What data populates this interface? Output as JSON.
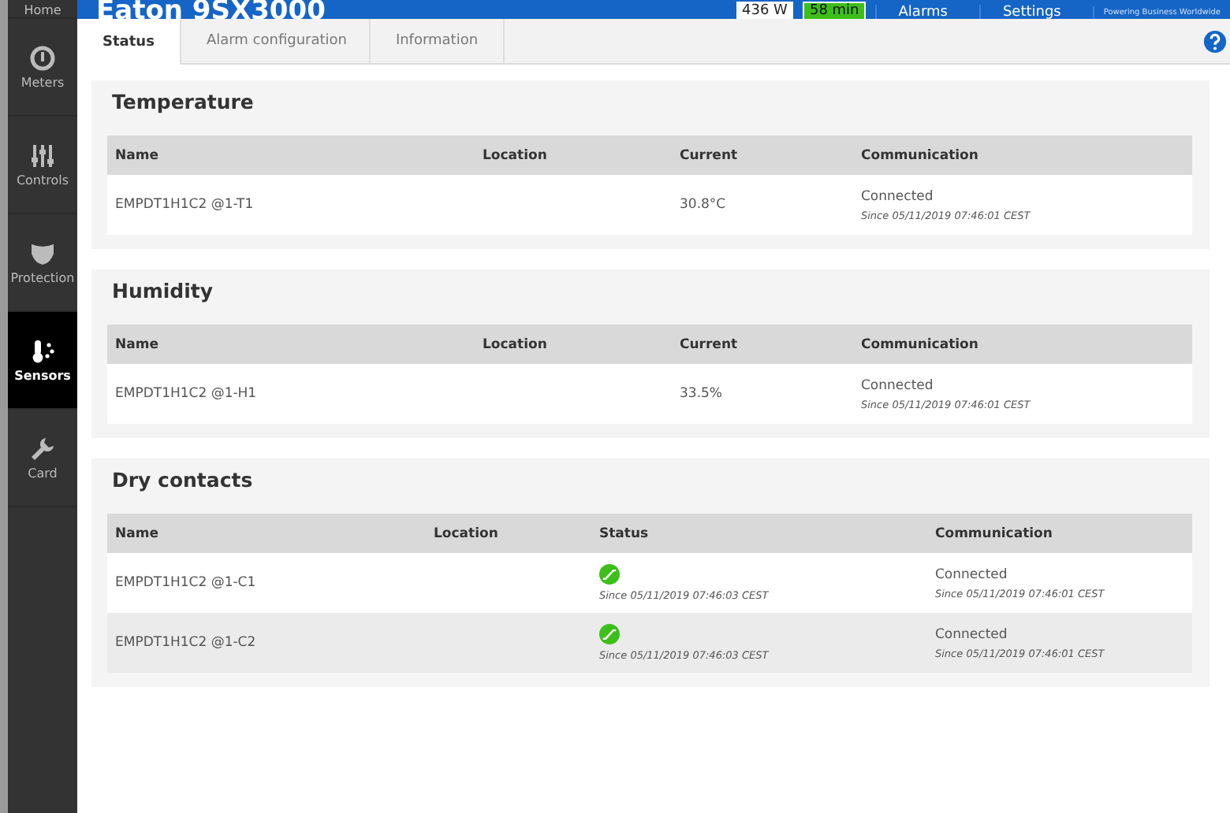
{
  "header": {
    "title": "Eaton 9SX3000",
    "power": "436 W",
    "runtime": "58 min",
    "menu": [
      "Alarms",
      "Settings"
    ],
    "tagline": "Powering Business Worldwide"
  },
  "sidebar": {
    "items": [
      {
        "label": "Home",
        "selected": false
      },
      {
        "label": "Meters",
        "selected": false
      },
      {
        "label": "Controls",
        "selected": false
      },
      {
        "label": "Protection",
        "selected": false
      },
      {
        "label": "Sensors",
        "selected": true
      },
      {
        "label": "Card",
        "selected": false
      }
    ]
  },
  "tabs": [
    {
      "label": "Status",
      "selected": true
    },
    {
      "label": "Alarm configuration",
      "selected": false
    },
    {
      "label": "Information",
      "selected": false
    }
  ],
  "sections": [
    {
      "title": "Temperature",
      "kind": "sensor",
      "columns": [
        "Name",
        "Location",
        "Current",
        "Communication"
      ],
      "rows": [
        {
          "name": "EMPDT1H1C2 @1-T1",
          "current": "30.8°C",
          "communication": "Connected",
          "since": "Since 05/11/2019 07:46:01 CEST"
        }
      ]
    },
    {
      "title": "Humidity",
      "kind": "sensor",
      "columns": [
        "Name",
        "Location",
        "Current",
        "Communication"
      ],
      "rows": [
        {
          "name": "EMPDT1H1C2 @1-H1",
          "current": "33.5%",
          "communication": "Connected",
          "since": "Since 05/11/2019 07:46:01 CEST"
        }
      ]
    },
    {
      "title": "Dry contacts",
      "kind": "contact",
      "columns": [
        "Name",
        "Location",
        "Status",
        "Communication"
      ],
      "rows": [
        {
          "name": "EMPDT1H1C2 @1-C1",
          "closed": true,
          "status_since": "Since 05/11/2019 07:46:03 CEST",
          "communication": "Connected",
          "since": "Since 05/11/2019 07:46:01 CEST"
        },
        {
          "name": "EMPDT1H1C2 @1-C2",
          "closed": true,
          "status_since": "Since 05/11/2019 07:46:03 CEST",
          "communication": "Connected",
          "since": "Since 05/11/2019 07:46:01 CEST"
        }
      ]
    }
  ]
}
